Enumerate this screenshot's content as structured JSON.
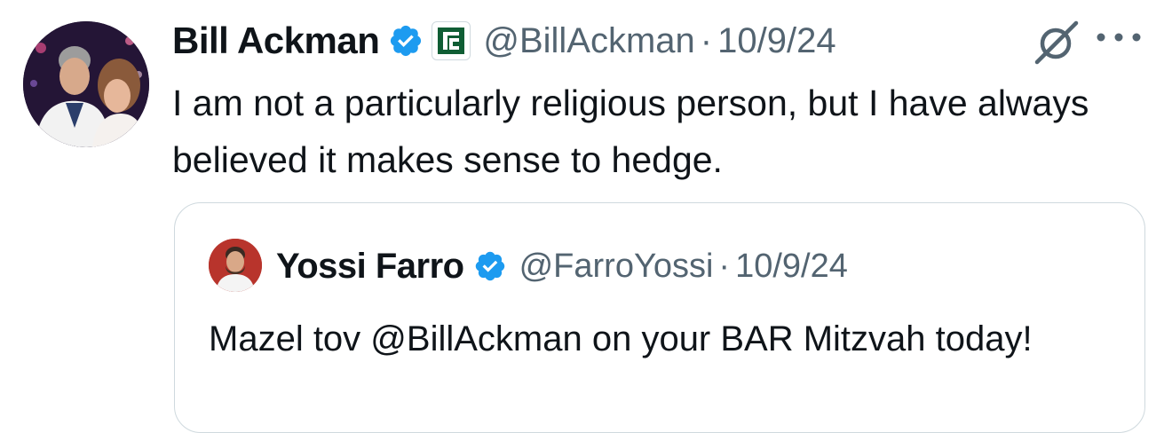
{
  "tweet": {
    "author_name": "Bill Ackman",
    "handle": "@BillAckman",
    "separator": "·",
    "date": "10/9/24",
    "text": "I am not a particularly religious person, but I have always believed it makes sense to hedge."
  },
  "quoted_tweet": {
    "author_name": "Yossi Farro",
    "handle": "@FarroYossi",
    "separator": "·",
    "date": "10/9/24",
    "text": "Mazel tov @BillAckman on your BAR Mitzvah today!"
  },
  "icons": {
    "verified": "verified-badge-icon",
    "affiliation": "affiliate-logo-icon",
    "grok": "grok-icon",
    "more": "more-options-icon"
  },
  "colors": {
    "verified_blue": "#1d9bf0",
    "text_primary": "#0f1419",
    "text_secondary": "#536471",
    "border": "#cfd9de",
    "affiliate_green": "#0f5d34"
  }
}
